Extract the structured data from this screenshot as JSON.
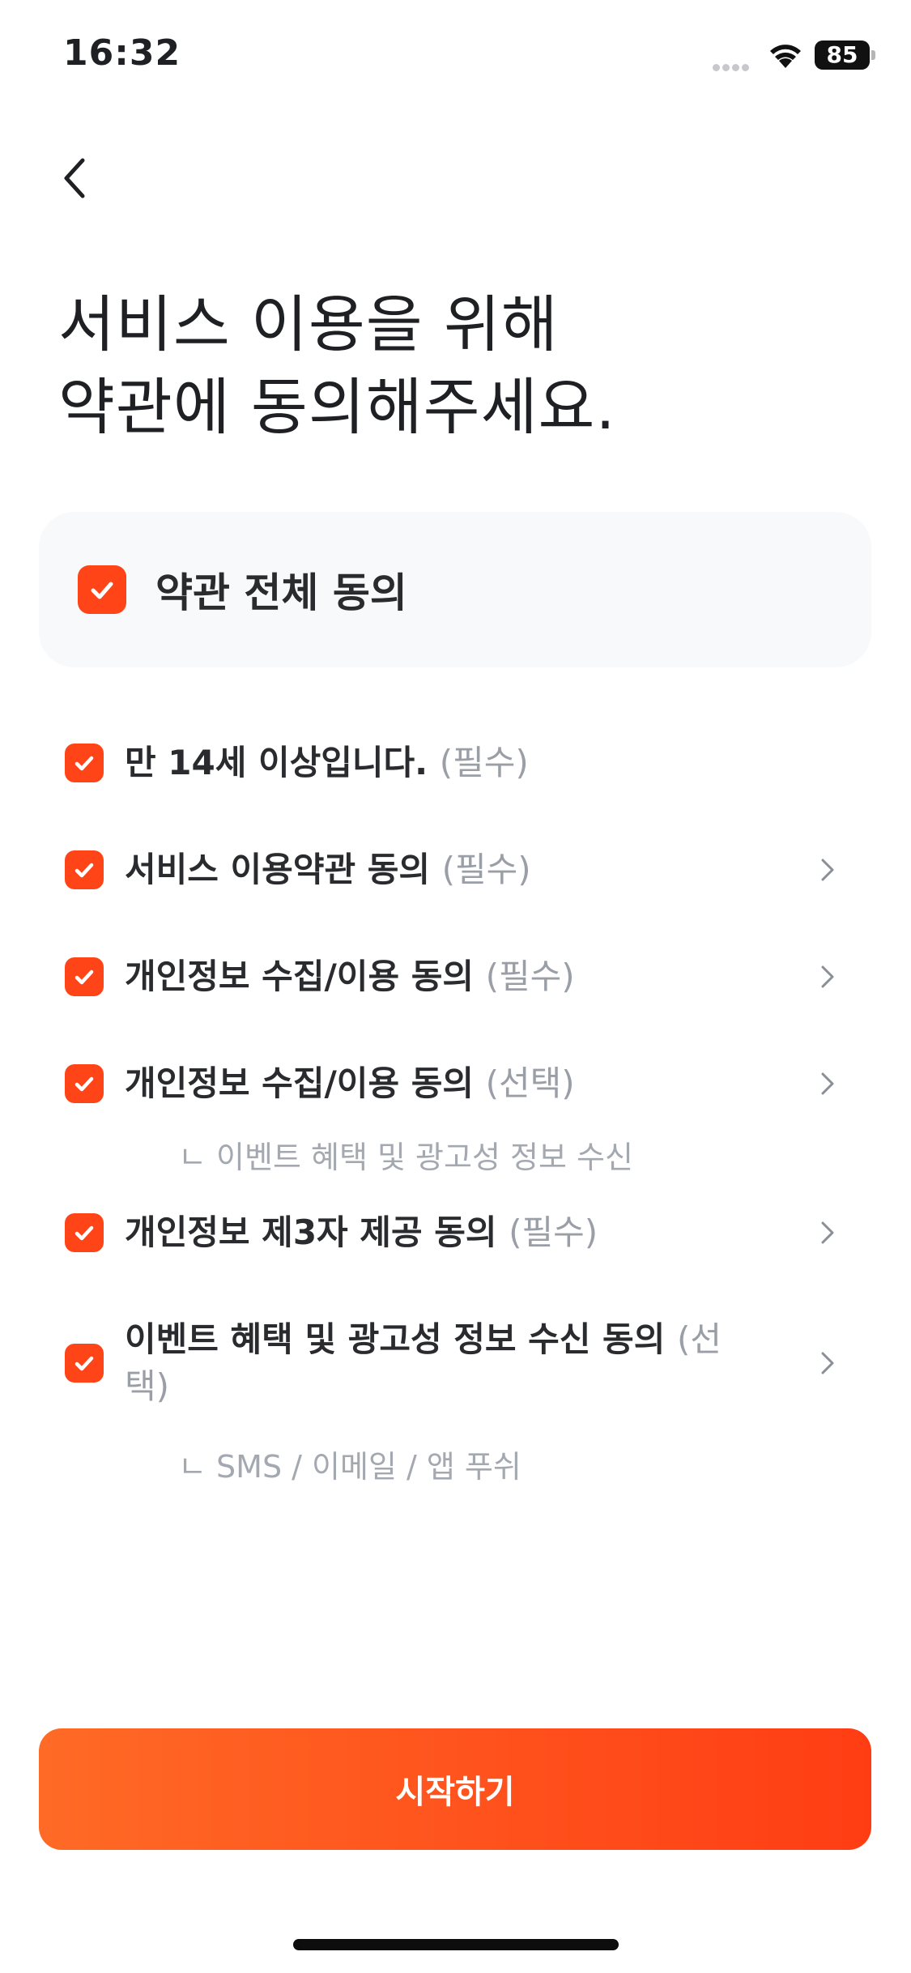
{
  "status_bar": {
    "time": "16:32",
    "battery": "85"
  },
  "header": {
    "back_icon": "chevron-left-icon"
  },
  "headline": {
    "line1": "서비스 이용을 위해",
    "line2": "약관에 동의해주세요."
  },
  "agree_all": {
    "label": "약관 전체 동의",
    "checked": true
  },
  "terms": [
    {
      "label": "만 14세 이상입니다.",
      "tag": "(필수)",
      "checked": true,
      "has_detail": false
    },
    {
      "label": "서비스 이용약관 동의",
      "tag": "(필수)",
      "checked": true,
      "has_detail": true
    },
    {
      "label": "개인정보 수집/이용 동의",
      "tag": "(필수)",
      "checked": true,
      "has_detail": true
    },
    {
      "label": "개인정보 수집/이용 동의",
      "tag": "(선택)",
      "checked": true,
      "has_detail": true,
      "note": "ㄴ 이벤트 혜택 및 광고성 정보 수신"
    },
    {
      "label": "개인정보 제3자 제공 동의",
      "tag": "(필수)",
      "checked": true,
      "has_detail": true
    },
    {
      "label": "이벤트 혜택 및 광고성 정보 수신 동의",
      "tag": "(선택)",
      "checked": true,
      "has_detail": true,
      "note": "ㄴ SMS / 이메일 / 앱 푸쉬"
    }
  ],
  "start_button": {
    "label": "시작하기"
  },
  "colors": {
    "accent": "#FF4418",
    "tag_gray": "#9A9EA6",
    "card_bg": "#F8F9FA"
  }
}
